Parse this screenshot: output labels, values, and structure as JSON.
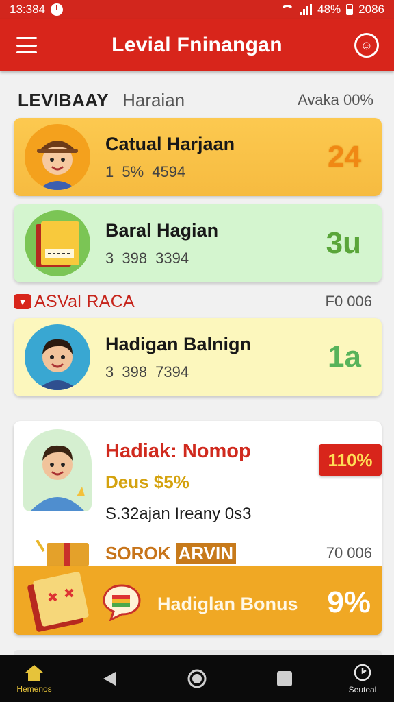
{
  "status_bar": {
    "time": "13:384",
    "battery_text": "48%",
    "extra": "2086"
  },
  "app_bar": {
    "title": "Levial Fninangan"
  },
  "section_top": {
    "title": "LEVIBAAY",
    "subtitle": "Haraian",
    "right": "Avaka 00%"
  },
  "cards": [
    {
      "title": "Catual Harjaan",
      "sub": "1 5% 4594",
      "num": "24"
    },
    {
      "title": "Baral Hagian",
      "sub": "3 398 3394",
      "num": "3u"
    },
    {
      "title": "Hadigan Balnign",
      "sub": "3 398 7394",
      "num": "1a"
    }
  ],
  "section_mid": {
    "title": "ASVal RACA",
    "right": "F0 006"
  },
  "promo": {
    "title": "Hadiak: Nomop",
    "sub": "Deus $5%",
    "line": "S.32ajan Ireany 0s3",
    "badge": "110%"
  },
  "section_bottom": {
    "title_a": "SOROK",
    "title_b": "ARVIN",
    "right": "70 006"
  },
  "bonus": {
    "label": "Hadiglan Bonus",
    "pct": "9%"
  },
  "nav": {
    "home_label": "Hemenos",
    "settings_label": "Seuteal"
  },
  "colors": {
    "brand_red": "#d8251b",
    "gold": "#f0a824"
  }
}
